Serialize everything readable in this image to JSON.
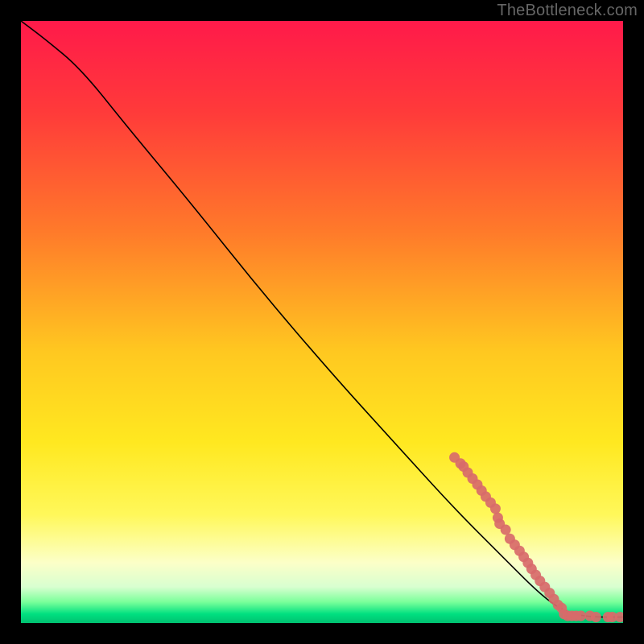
{
  "watermark": "TheBottleneck.com",
  "chart_data": {
    "type": "line",
    "title": "",
    "xlabel": "",
    "ylabel": "",
    "xlim": [
      0,
      100
    ],
    "ylim": [
      0,
      100
    ],
    "gradient_stops": [
      {
        "offset": 0.0,
        "color": "#ff1a4a"
      },
      {
        "offset": 0.15,
        "color": "#ff3a3a"
      },
      {
        "offset": 0.35,
        "color": "#ff7a2a"
      },
      {
        "offset": 0.55,
        "color": "#ffc820"
      },
      {
        "offset": 0.7,
        "color": "#ffe820"
      },
      {
        "offset": 0.82,
        "color": "#fff85a"
      },
      {
        "offset": 0.9,
        "color": "#fcffc8"
      },
      {
        "offset": 0.94,
        "color": "#d8ffd0"
      },
      {
        "offset": 0.965,
        "color": "#7aff9a"
      },
      {
        "offset": 0.985,
        "color": "#00e080"
      },
      {
        "offset": 1.0,
        "color": "#00c070"
      }
    ],
    "curve": [
      {
        "x": 0,
        "y": 100
      },
      {
        "x": 4,
        "y": 97
      },
      {
        "x": 10,
        "y": 92
      },
      {
        "x": 18,
        "y": 82
      },
      {
        "x": 28,
        "y": 70
      },
      {
        "x": 40,
        "y": 55
      },
      {
        "x": 52,
        "y": 41
      },
      {
        "x": 62,
        "y": 30
      },
      {
        "x": 72,
        "y": 19
      },
      {
        "x": 80,
        "y": 11
      },
      {
        "x": 86,
        "y": 5
      },
      {
        "x": 90,
        "y": 2
      },
      {
        "x": 94,
        "y": 1
      },
      {
        "x": 100,
        "y": 1
      }
    ],
    "scatter": [
      {
        "x": 72,
        "y": 27.5
      },
      {
        "x": 73,
        "y": 26.5
      },
      {
        "x": 73.5,
        "y": 26
      },
      {
        "x": 74.2,
        "y": 25
      },
      {
        "x": 75,
        "y": 24
      },
      {
        "x": 75.8,
        "y": 23
      },
      {
        "x": 76.5,
        "y": 22
      },
      {
        "x": 77.2,
        "y": 21
      },
      {
        "x": 78,
        "y": 20
      },
      {
        "x": 78.8,
        "y": 19
      },
      {
        "x": 79.2,
        "y": 17.5
      },
      {
        "x": 79.5,
        "y": 16.5
      },
      {
        "x": 80.5,
        "y": 15.5
      },
      {
        "x": 81.2,
        "y": 14
      },
      {
        "x": 82,
        "y": 13
      },
      {
        "x": 82.8,
        "y": 12
      },
      {
        "x": 83.5,
        "y": 11
      },
      {
        "x": 84.2,
        "y": 10
      },
      {
        "x": 84.8,
        "y": 9
      },
      {
        "x": 85.5,
        "y": 8
      },
      {
        "x": 86.2,
        "y": 7
      },
      {
        "x": 87,
        "y": 6
      },
      {
        "x": 87.8,
        "y": 5
      },
      {
        "x": 88.5,
        "y": 4
      },
      {
        "x": 89.2,
        "y": 3
      },
      {
        "x": 89.8,
        "y": 2.5
      },
      {
        "x": 90.2,
        "y": 1.5
      },
      {
        "x": 90.8,
        "y": 1.2
      },
      {
        "x": 91.5,
        "y": 1.2
      },
      {
        "x": 92.2,
        "y": 1.2
      },
      {
        "x": 93.0,
        "y": 1.2
      },
      {
        "x": 94.5,
        "y": 1.2
      },
      {
        "x": 95.5,
        "y": 1.0
      },
      {
        "x": 97.5,
        "y": 1.0
      },
      {
        "x": 98.2,
        "y": 1.0
      },
      {
        "x": 99.5,
        "y": 1.0
      }
    ]
  }
}
